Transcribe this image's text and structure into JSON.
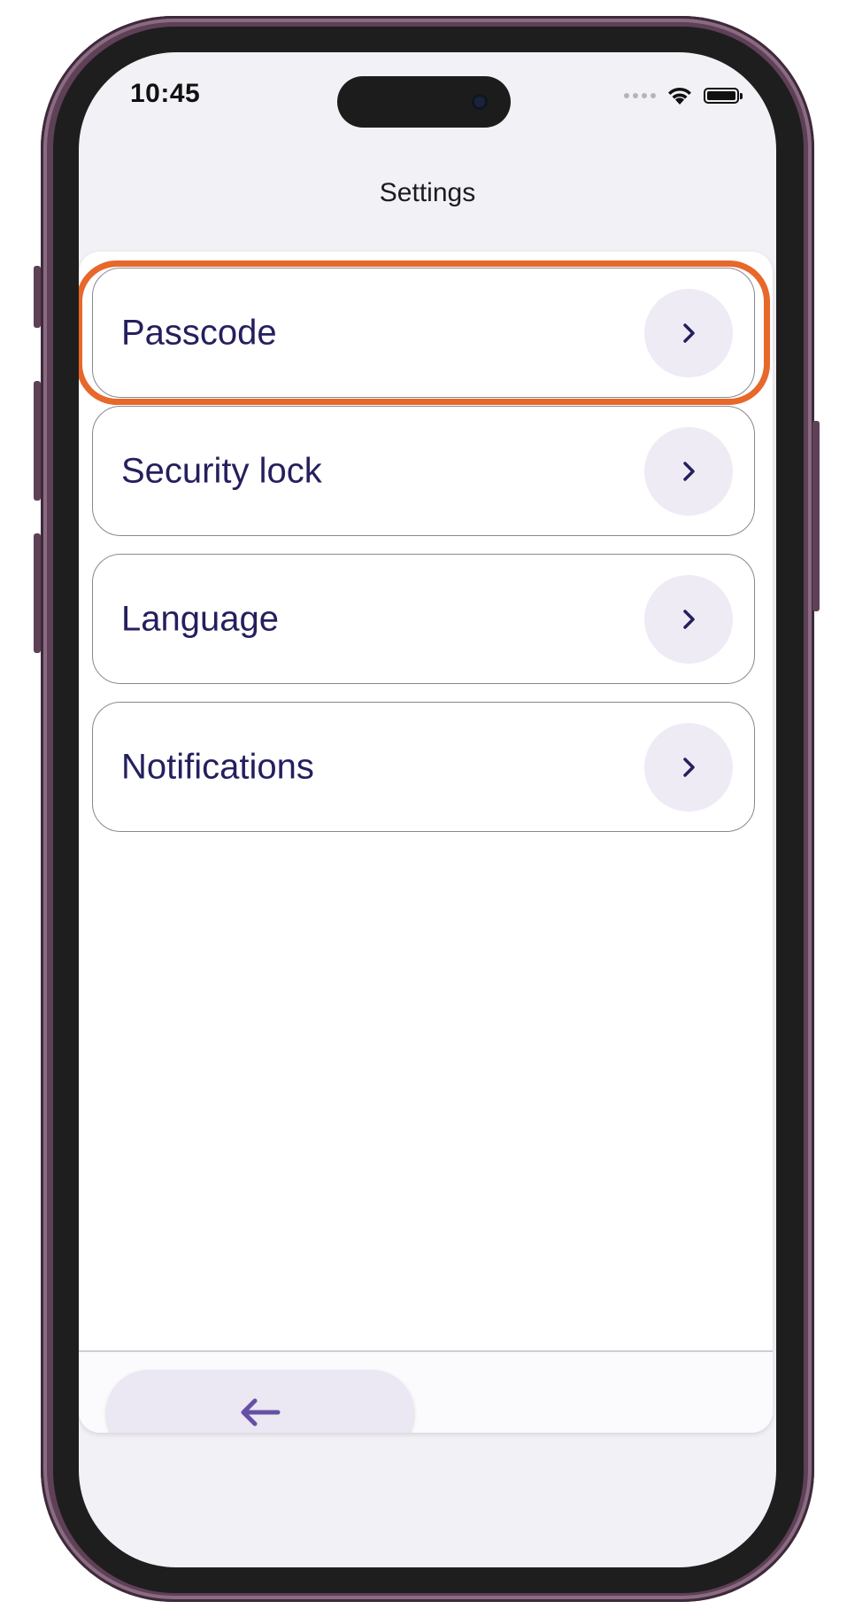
{
  "status_bar": {
    "time": "10:45"
  },
  "header": {
    "title": "Settings"
  },
  "settings": {
    "items": [
      {
        "label": "Passcode",
        "icon": "chevron-right-icon",
        "highlighted": true
      },
      {
        "label": "Security lock",
        "icon": "chevron-right-icon",
        "highlighted": false
      },
      {
        "label": "Language",
        "icon": "chevron-right-icon",
        "highlighted": false
      },
      {
        "label": "Notifications",
        "icon": "chevron-right-icon",
        "highlighted": false
      }
    ]
  },
  "footer": {
    "back_icon": "arrow-left-icon"
  },
  "colors": {
    "text_accent": "#241f5e",
    "highlight": "#e8672a",
    "chip_bg": "#eeebf5",
    "back_icon": "#6550a4"
  }
}
